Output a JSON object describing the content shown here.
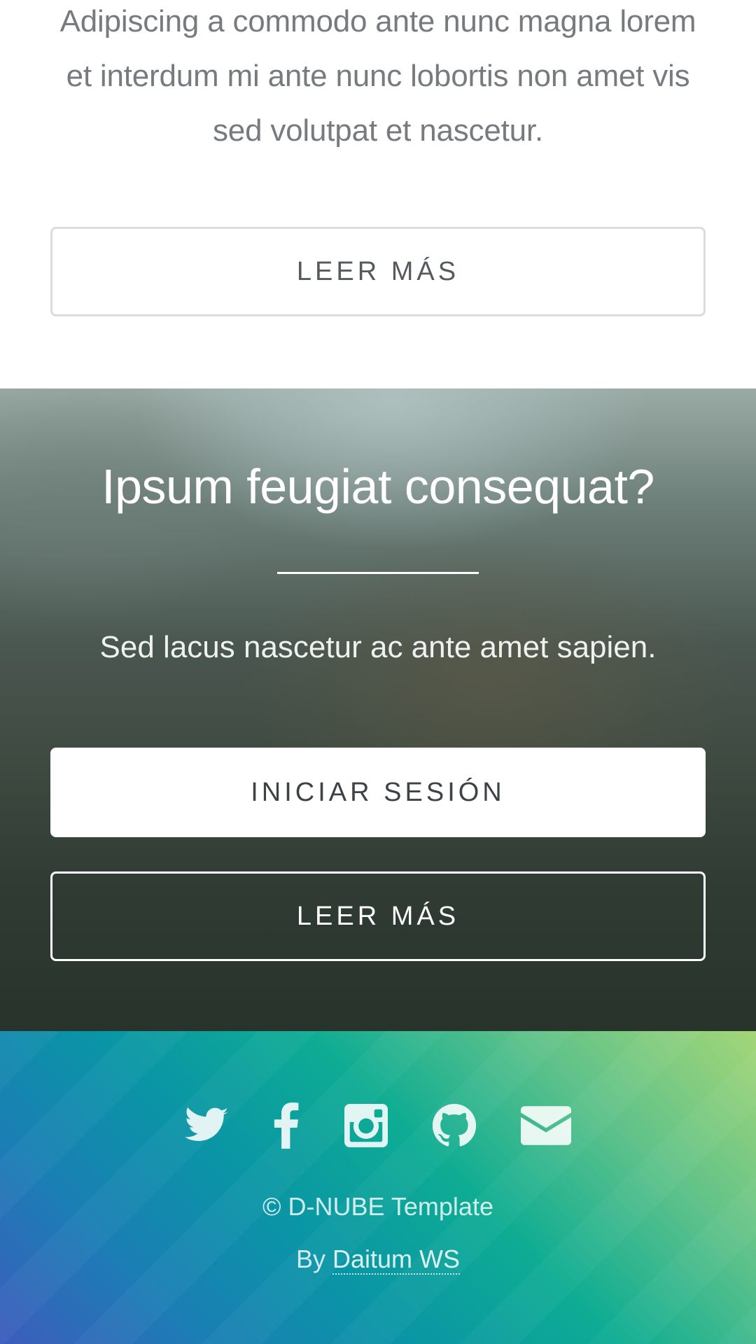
{
  "intro": {
    "text": "Adipiscing a commodo ante nunc magna lorem et interdum mi ante nunc lobortis non amet vis sed volutpat et nascetur.",
    "read_more_label": "LEER MÁS"
  },
  "cta": {
    "title": "Ipsum feugiat consequat?",
    "subtitle": "Sed lacus nascetur ac ante amet sapien.",
    "login_label": "INICIAR SESIÓN",
    "read_more_label": "LEER MÁS"
  },
  "footer": {
    "social_icons": [
      "twitter-icon",
      "facebook-icon",
      "instagram-icon",
      "github-icon",
      "envelope-icon"
    ],
    "copyright": "© D-NUBE Template",
    "by_prefix": "By",
    "author_link": "Daitum WS"
  }
}
